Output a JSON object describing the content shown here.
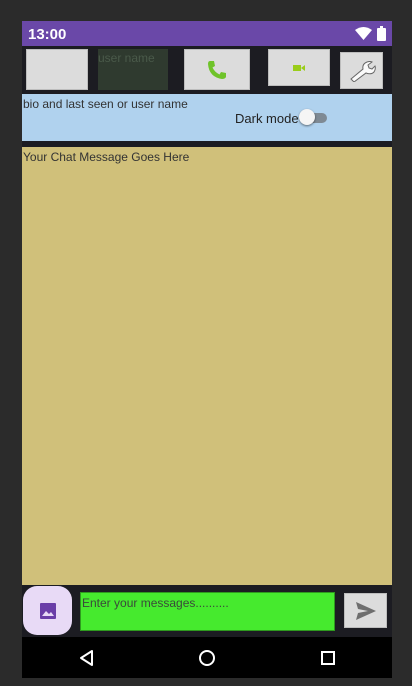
{
  "status_bar": {
    "time": "13:00",
    "wifi_icon": "wifi-icon",
    "battery_icon": "battery-icon"
  },
  "toolbar": {
    "user_name_placeholder": "user name",
    "call_icon": "phone-icon",
    "video_icon": "video-icon",
    "settings_icon": "wrench-icon",
    "call_color": "#6fc32a",
    "video_color": "#9acd1a"
  },
  "info_bar": {
    "bio_text": "bio and last seen or user name",
    "dark_mode_label": "Dark mode",
    "dark_mode_on": false
  },
  "chat": {
    "message_text": "Your Chat Message Goes Here"
  },
  "composer": {
    "input_placeholder": "Enter your messages..........",
    "attach_icon": "image-icon",
    "send_icon": "send-icon"
  },
  "nav": {
    "back_icon": "back-icon",
    "home_icon": "home-icon",
    "recents_icon": "recents-icon"
  },
  "colors": {
    "status_bar": "#6a48a8",
    "info_bar": "#b0d2ee",
    "chat_bg": "#d0c07a",
    "input_bg": "#46ea2e",
    "attach_bg": "#e8daf6"
  }
}
